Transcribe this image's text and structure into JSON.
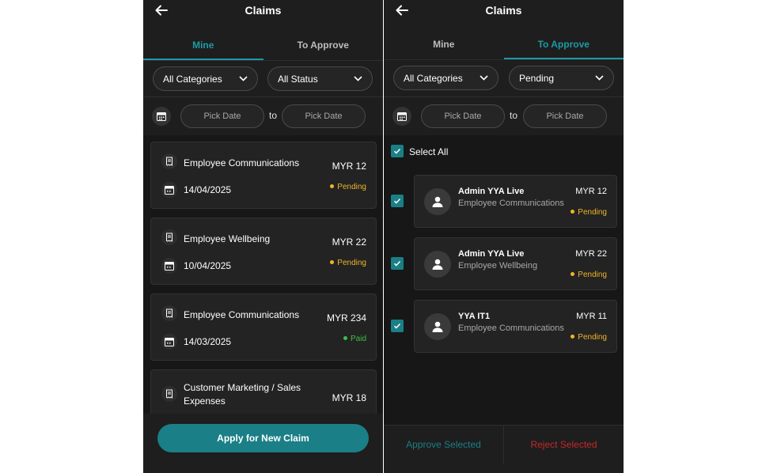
{
  "colors": {
    "accent": "#1d9aa5",
    "background": "#1e1e1e",
    "pending": "#f0b429",
    "paid": "#3fbf4a",
    "reject": "#c62828"
  },
  "left": {
    "title": "Claims",
    "tabs": [
      "Mine",
      "To Approve"
    ],
    "active_tab": "Mine",
    "category_filter": "All Categories",
    "status_filter": "All Status",
    "date_from": "Pick Date",
    "date_to": "Pick Date",
    "to_label": "to",
    "claims": [
      {
        "category": "Employee Communications",
        "amount": "MYR 12",
        "date": "14/04/2025",
        "status": "Pending"
      },
      {
        "category": "Employee Wellbeing",
        "amount": "MYR 22",
        "date": "10/04/2025",
        "status": "Pending"
      },
      {
        "category": "Employee Communications",
        "amount": "MYR 234",
        "date": "14/03/2025",
        "status": "Paid"
      },
      {
        "category": "Customer Marketing / Sales Expenses",
        "amount": "MYR 18",
        "date": "",
        "status": ""
      }
    ],
    "apply_button": "Apply for New Claim"
  },
  "right": {
    "title": "Claims",
    "tabs": [
      "Mine",
      "To Approve"
    ],
    "active_tab": "To Approve",
    "category_filter": "All Categories",
    "status_filter": "Pending",
    "date_from": "Pick Date",
    "date_to": "Pick Date",
    "to_label": "to",
    "select_all": "Select All",
    "approvals": [
      {
        "name": "Admin YYA Live",
        "category": "Employee Communications",
        "amount": "MYR 12",
        "status": "Pending"
      },
      {
        "name": "Admin YYA Live",
        "category": "Employee Wellbeing",
        "amount": "MYR 22",
        "status": "Pending"
      },
      {
        "name": "YYA IT1",
        "category": "Employee Communications",
        "amount": "MYR 11",
        "status": "Pending"
      }
    ],
    "approve_button": "Approve Selected",
    "reject_button": "Reject Selected"
  },
  "icons": [
    "back-arrow-icon",
    "chevron-down-icon",
    "calendar-icon",
    "receipt-icon",
    "checkmark-icon",
    "user-icon"
  ]
}
